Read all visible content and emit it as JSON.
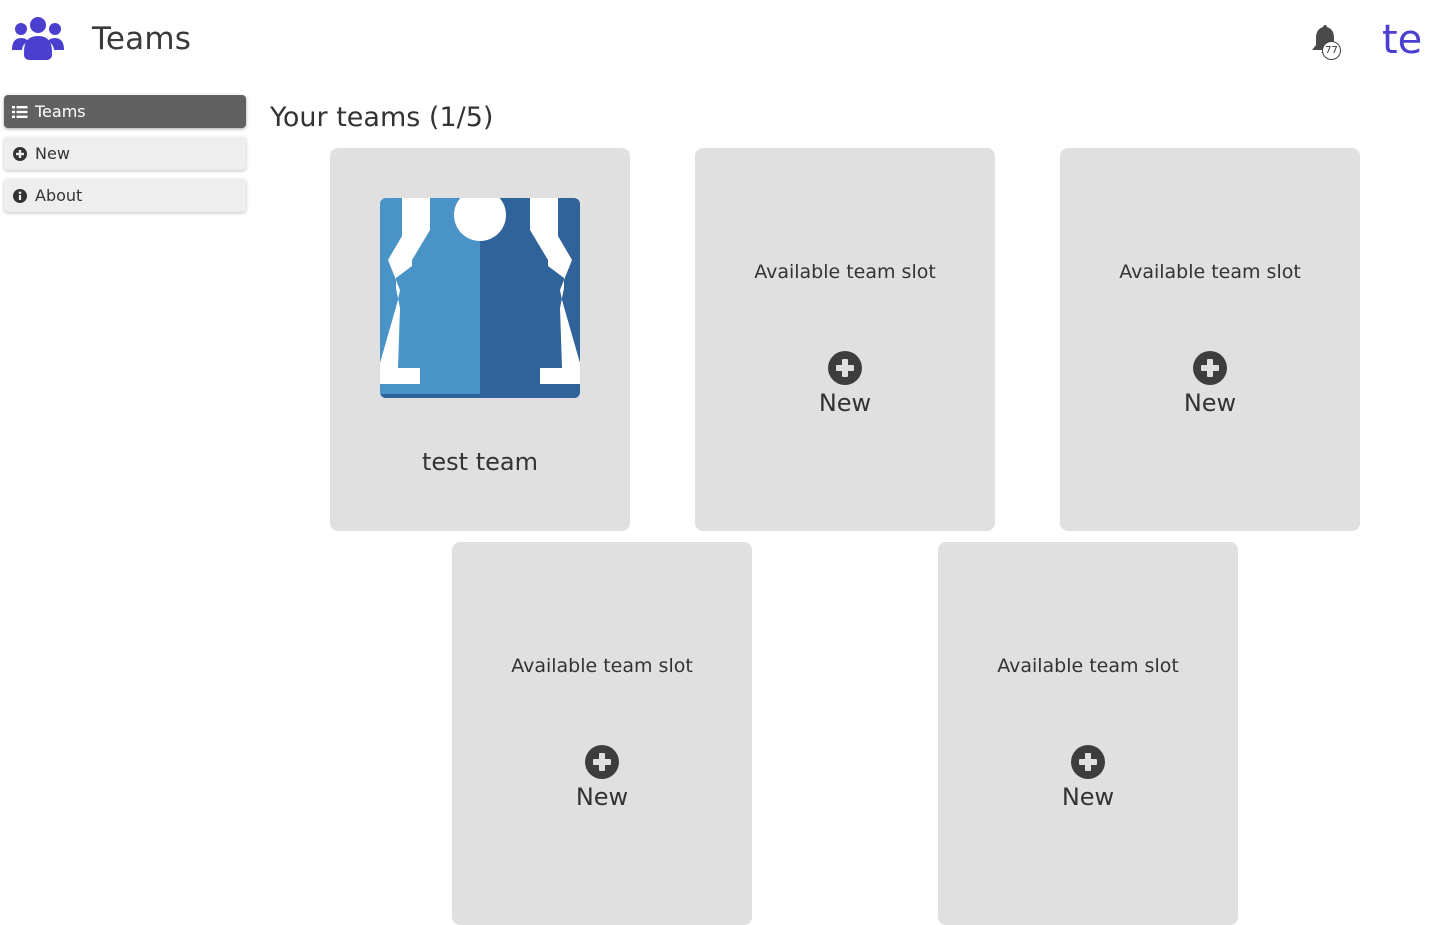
{
  "header": {
    "title": "Teams",
    "notification_count": "77",
    "user_initials": "te"
  },
  "sidebar": {
    "items": [
      {
        "label": "Teams",
        "icon": "list-icon",
        "active": true
      },
      {
        "label": "New",
        "icon": "plus-circle-icon",
        "active": false
      },
      {
        "label": "About",
        "icon": "info-circle-icon",
        "active": false
      }
    ]
  },
  "main": {
    "heading": "Your teams (1/5)",
    "teams": [
      {
        "name": "test team"
      }
    ],
    "slots": [
      {
        "text": "Available team slot",
        "action": "New"
      },
      {
        "text": "Available team slot",
        "action": "New"
      },
      {
        "text": "Available team slot",
        "action": "New"
      },
      {
        "text": "Available team slot",
        "action": "New"
      }
    ]
  },
  "colors": {
    "accent": "#4b3fcf",
    "card_bg": "#e0e0e0",
    "sidebar_active": "#616161",
    "team_image_light": "#4a93c6",
    "team_image_dark": "#2f6399"
  }
}
